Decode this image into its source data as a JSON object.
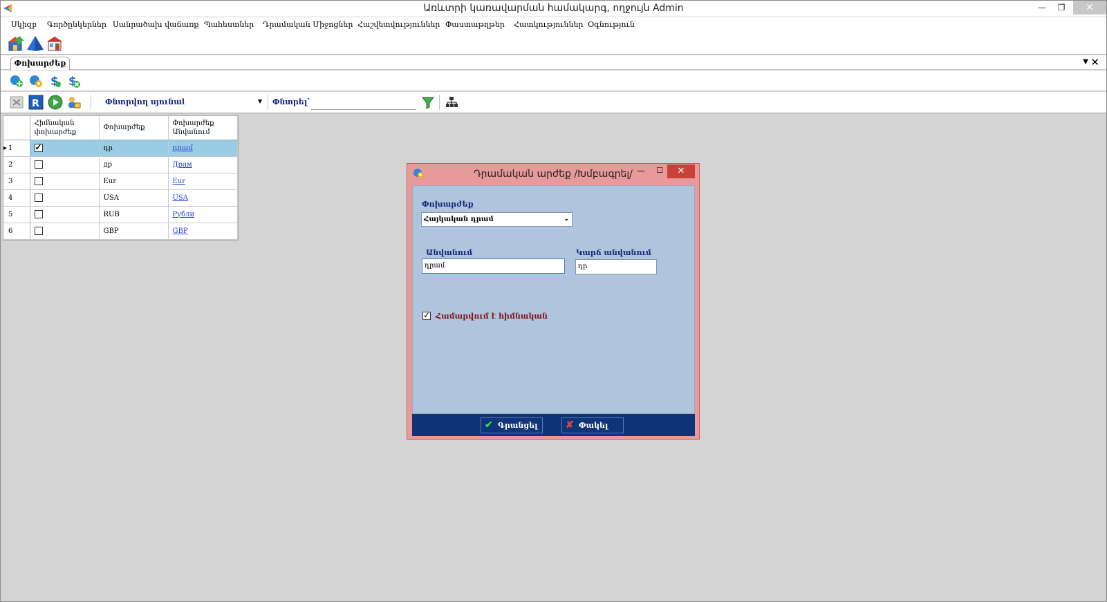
{
  "window": {
    "title": "Առևտրի կառավարման համակարգ, ողջույն Admin",
    "minimize": "—",
    "restore": "❐",
    "close": "✕"
  },
  "menu": [
    {
      "label": "Սկիզբ"
    },
    {
      "label": "Գործընկերներ"
    },
    {
      "label": "Սանրածախ վաճառք"
    },
    {
      "label": "Պահեստներ"
    },
    {
      "label": "Դրամական Միջոցներ"
    },
    {
      "label": "Հաշվետվություններ"
    },
    {
      "label": "Փաստաթղթեր"
    },
    {
      "label": "Հատկություններ"
    },
    {
      "label": "Օգնություն"
    }
  ],
  "tab": {
    "label": "Փոխարժեք",
    "dropdown": "▼",
    "close": "✕"
  },
  "filter_bar": {
    "search_column_label": "Փնտրվող սյունակ՝",
    "search_column_value": "",
    "search_label": "Փնտրել՝",
    "search_value": ""
  },
  "grid": {
    "headers": [
      "Հիմնական փոխարժեք",
      "Փոխարժեք",
      "Փոխարժեք Անվանում"
    ],
    "rows": [
      {
        "num": "1",
        "checked": true,
        "code": "դր",
        "name": "դրամ",
        "selected": true
      },
      {
        "num": "2",
        "checked": false,
        "code": "др",
        "name": "Драм",
        "selected": false
      },
      {
        "num": "3",
        "checked": false,
        "code": "Eur",
        "name": "Eur",
        "selected": false
      },
      {
        "num": "4",
        "checked": false,
        "code": "USA",
        "name": "USA",
        "selected": false
      },
      {
        "num": "5",
        "checked": false,
        "code": "RUB",
        "name": "Рубли",
        "selected": false
      },
      {
        "num": "6",
        "checked": false,
        "code": "GBP",
        "name": "GBP",
        "selected": false
      }
    ]
  },
  "dialog": {
    "title": "Դրամական արժեք /Խմբագրել/",
    "currency_label": "Փոխարժեք",
    "currency_value": "Հայկական դրամ",
    "name_label": "Անվանում",
    "name_value": "դրամ",
    "short_name_label": "Կարճ անվանում",
    "short_name_value": "դր",
    "base_check_label": "Համարվում է հիմնական",
    "base_checked": true,
    "ok_label": "Գրանցել",
    "cancel_label": "Փակել"
  },
  "colors": {
    "dialog_frame": "#e89a9a",
    "dialog_body": "#b1c4de",
    "dialog_footer": "#0e3579",
    "selected_row": "#99cde6",
    "label_blue": "#10257a",
    "check_label": "#7b1313"
  }
}
